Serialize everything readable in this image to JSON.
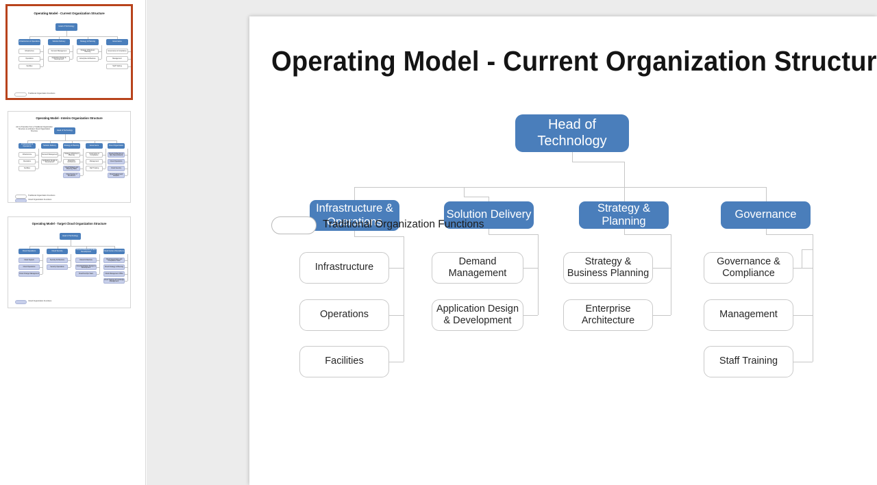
{
  "app": {
    "selected_slide_index": 1
  },
  "sidebar": {
    "slides": [
      {
        "number": "1",
        "title": "Operating Model - Current Organization Structure",
        "selected": true,
        "legend": [
          {
            "label": "Traditional Organization Functions",
            "style": "white"
          }
        ],
        "head": "Head of Technology",
        "columns": [
          {
            "header": "Infrastructure & Operations",
            "items": [
              "Infrastructure",
              "Operations",
              "Facilities"
            ]
          },
          {
            "header": "Solution Delivery",
            "items": [
              "Demand Management",
              "Application Design & Development"
            ]
          },
          {
            "header": "Strategy & Planning",
            "items": [
              "Strategy & Business Planning",
              "Enterprise Architecture"
            ]
          },
          {
            "header": "Governance",
            "items": [
              "Governance & Compliance",
              "Management",
              "Staff Training"
            ]
          }
        ]
      },
      {
        "number": "2",
        "title": "Operating Model - Interim Organization Structure",
        "selected": false,
        "note": "Aim to Transition from a Traditional Organization Structure to a Modern Cloud Organization Structure",
        "legend": [
          {
            "label": "Traditional Organization Functions",
            "style": "white"
          },
          {
            "label": "Cloud Organization Functions",
            "style": "lavender"
          }
        ],
        "head": "Head of Technology",
        "columns": [
          {
            "header": "Infrastructure & Operations",
            "items": [
              "Infrastructure",
              "Operations",
              "Facilities"
            ]
          },
          {
            "header": "Solution Delivery",
            "items": [
              "Demand Management",
              "Application Design & Development"
            ]
          },
          {
            "header": "Strategy & Planning",
            "items": [
              "Strategy & Business Planning",
              "Enterprise Architecture",
              "Cloud Strategy and Planning Team",
              "Cloud Center of Excellence"
            ]
          },
          {
            "header": "Governance",
            "items": [
              "Governance & Compliance",
              "Management",
              "Staff Training"
            ]
          },
          {
            "header": "Cloud Organization",
            "items": [
              "Cloud Architecture & Ops (Secondment)",
              "Cloud Operations",
              "Cloud Security",
              "Cloud Support and Adoption"
            ]
          }
        ]
      },
      {
        "number": "3",
        "title": "Operating Model - Target Cloud Organization Structure",
        "selected": false,
        "legend": [
          {
            "label": "Cloud Organization Functions",
            "style": "lavender"
          }
        ],
        "head": "Head of Technology",
        "columns": [
          {
            "header": "Cloud Operations",
            "items": [
              "Cloud Support",
              "Cloud Operations",
              "Cloud Change Management"
            ]
          },
          {
            "header": "Cloud Security",
            "items": [
              "Security Architecture",
              "Security Operations"
            ]
          },
          {
            "header": "Cloud Architecture & New Development",
            "items": [
              "Cloud Architecture",
              "Cloud Application Design & Development",
              "Cloud DevOps Team"
            ]
          },
          {
            "header": "Cloud Center of Excellence",
            "items": [
              "Cloud Governance and Compliance Team",
              "Cloud Strategy & Planning",
              "Cloud Management Office",
              "Cloud Training & Knowledge Management"
            ]
          }
        ]
      }
    ]
  },
  "slide": {
    "title": "Operating Model - Current Organization Structure",
    "head": {
      "label": "Head of Technology"
    },
    "branches": [
      {
        "label": "Infrastructure & Operations",
        "children": [
          "Infrastructure",
          "Operations",
          "Facilities"
        ]
      },
      {
        "label": "Solution Delivery",
        "children": [
          "Demand Management",
          "Application Design & Development"
        ]
      },
      {
        "label": "Strategy & Planning",
        "children": [
          "Strategy & Business Planning",
          "Enterprise Architecture"
        ]
      },
      {
        "label": "Governance",
        "children": [
          "Governance & Compliance",
          "Management",
          "Staff Training"
        ]
      }
    ],
    "legend": {
      "label": "Traditional Organization Functions"
    }
  },
  "colors": {
    "node_blue": "#4a7ebb",
    "node_white": "#ffffff",
    "connector": "#c6c6c6",
    "selection_border": "#b8431c",
    "canvas_bg": "#ececec",
    "lavender": "#c7cfea"
  }
}
